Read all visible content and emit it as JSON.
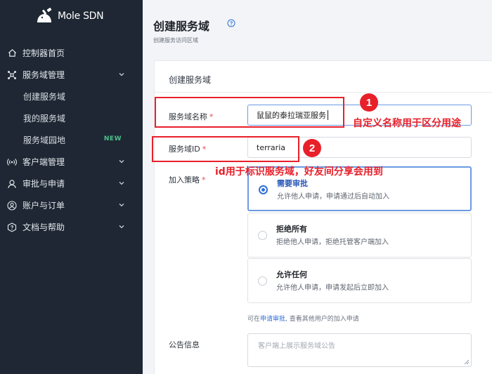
{
  "brand": {
    "name": "Mole SDN"
  },
  "sidebar": {
    "items": [
      {
        "label": "控制器首页",
        "icon": "home-icon"
      },
      {
        "label": "服务域管理",
        "icon": "cluster-icon",
        "expandable": true
      },
      {
        "label": "创建服务域",
        "sub": true
      },
      {
        "label": "我的服务域",
        "sub": true
      },
      {
        "label": "服务域园地",
        "sub": true,
        "badge": "NEW"
      },
      {
        "label": "客户端管理",
        "icon": "broadcast-icon",
        "expandable": true
      },
      {
        "label": "审批与申请",
        "icon": "approve-icon",
        "expandable": true
      },
      {
        "label": "账户与订单",
        "icon": "account-icon",
        "expandable": true
      },
      {
        "label": "文档与帮助",
        "icon": "help-doc-icon",
        "expandable": true
      }
    ]
  },
  "page": {
    "title": "创建服务域",
    "subtitle": "创建服务访问区域"
  },
  "form": {
    "card_title": "创建服务域",
    "name_label": "服务域名称",
    "name_value": "鼠鼠的泰拉瑞亚服务",
    "id_label": "服务域ID",
    "id_value": "terraria",
    "required_mark": "*",
    "policy_label": "加入策略",
    "options": [
      {
        "title": "需要审批",
        "desc": "允许他人申请，申请通过后自动加入",
        "selected": true
      },
      {
        "title": "拒绝所有",
        "desc": "拒绝他人申请，拒绝托管客户端加入",
        "selected": false
      },
      {
        "title": "允许任何",
        "desc": "允许他人申请，申请发起后立即加入",
        "selected": false
      }
    ],
    "hint_prefix": "可在",
    "hint_link": "申请审批",
    "hint_suffix": ", 查看其他用户的加入申请",
    "notice_label": "公告信息",
    "notice_placeholder": "客户端上展示服务域公告"
  },
  "annotations": {
    "badge_1": "1",
    "badge_2": "2",
    "note_1": "自定义名称用于区分用途",
    "note_2": "id用于标识服务域，好友间分享会用到"
  },
  "colors": {
    "sidebar_bg": "#1e2733",
    "accent": "#2f6fd6",
    "annotation_red": "#e8202a",
    "new_badge": "#4cc38a"
  }
}
